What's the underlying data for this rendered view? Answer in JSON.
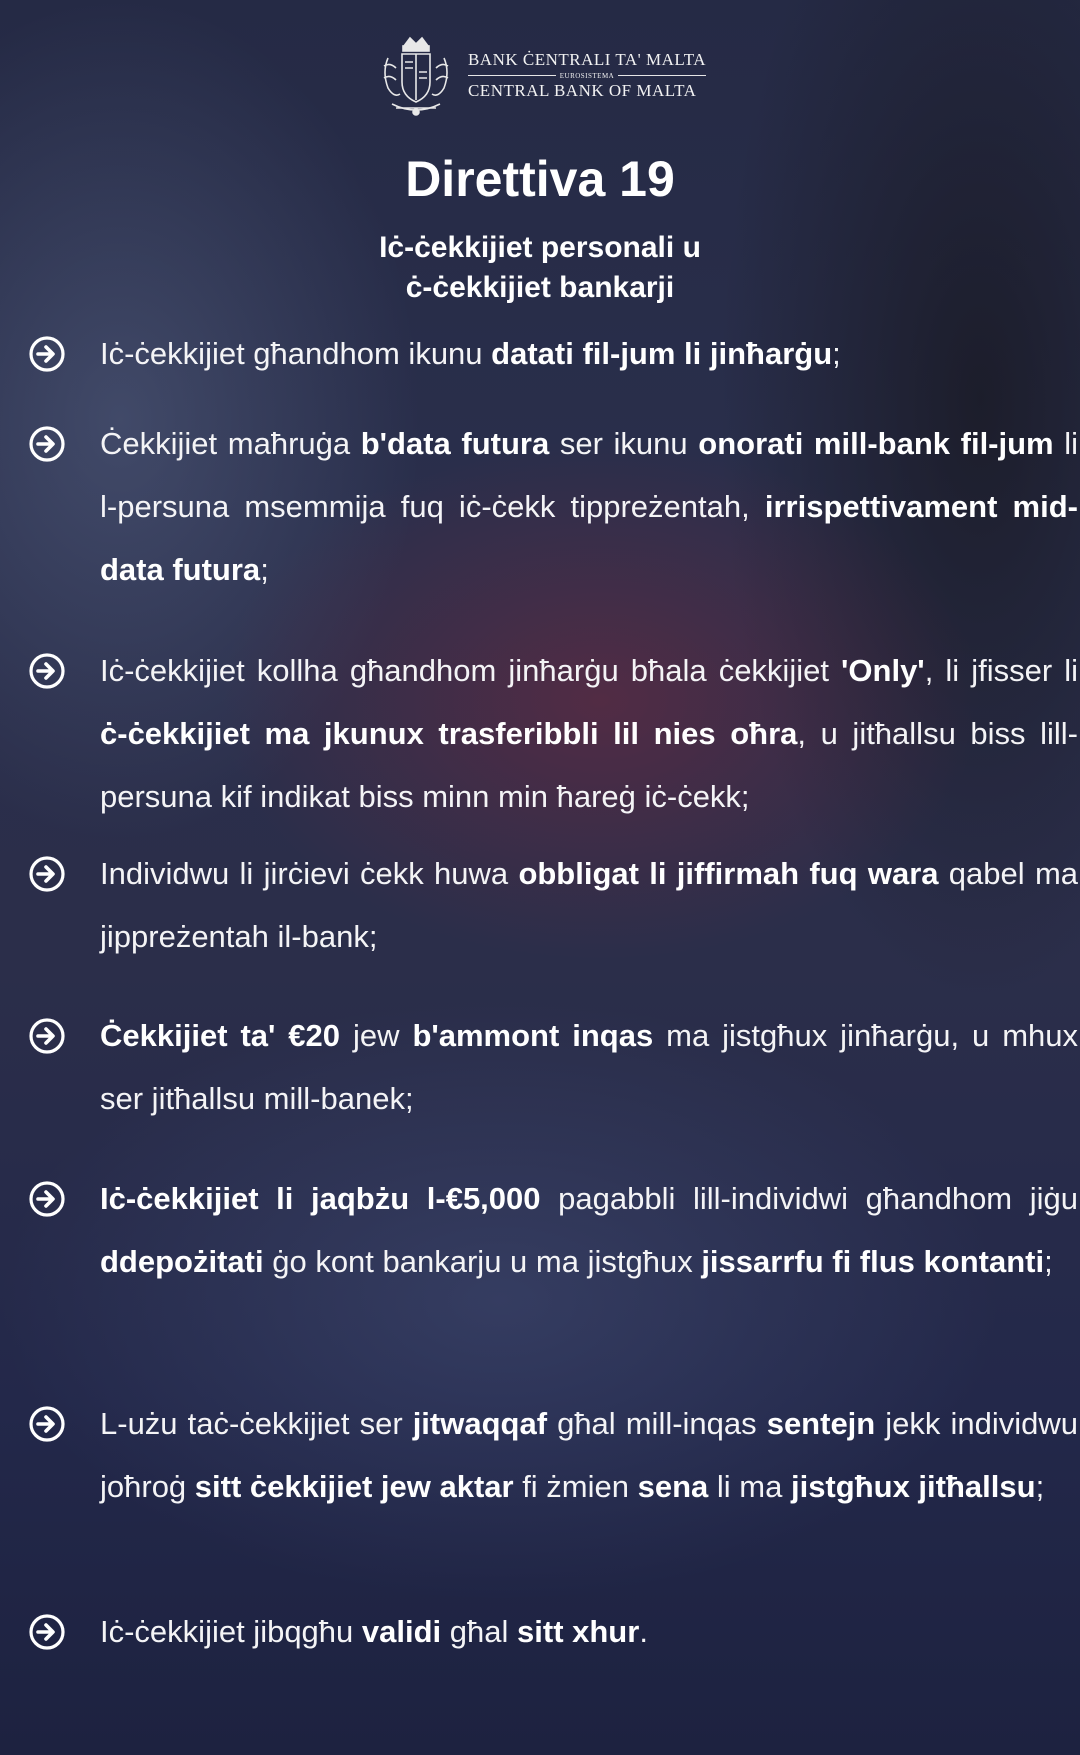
{
  "header": {
    "bank_name_mt": "BANK ĊENTRALI TA' MALTA",
    "eurosystem": "EUROSISTEMA",
    "bank_name_en": "CENTRAL BANK OF MALTA",
    "crest_icon": "coat-of-arms-icon"
  },
  "title": "Direttiva 19",
  "subtitle": {
    "line1": "Iċ-ċekkijiet personali u",
    "line2": "ċ-ċekkijiet bankarji"
  },
  "bullet_icon": "circled-arrow-right-icon",
  "items": [
    {
      "segments": [
        {
          "t": "Iċ-ċekkijiet għandhom ikunu "
        },
        {
          "t": "datati fil-jum li jinħarġu",
          "b": true
        },
        {
          "t": ";"
        }
      ]
    },
    {
      "segments": [
        {
          "t": "Ċekkijiet maħruġa "
        },
        {
          "t": "b'data futura",
          "b": true
        },
        {
          "t": " ser ikunu "
        },
        {
          "t": "onorati mill-bank fil-jum",
          "b": true
        },
        {
          "t": " li l-persuna msemmija fuq iċ-ċekk tippreżentah, "
        },
        {
          "t": "irrispettivament mid-data futura",
          "b": true
        },
        {
          "t": ";"
        }
      ]
    },
    {
      "segments": [
        {
          "t": "Iċ-ċekkijiet kollha għandhom jinħarġu bħala ċekkijiet "
        },
        {
          "t": "'Only'",
          "b": true
        },
        {
          "t": ", li jfisser li "
        },
        {
          "t": "ċ-ċekkijiet ma jkunux trasferibbli lil nies oħra",
          "b": true
        },
        {
          "t": ", u jitħallsu biss lill-persuna kif indikat biss minn min ħareġ iċ-ċekk;"
        }
      ]
    },
    {
      "segments": [
        {
          "t": "Individwu li jirċievi ċekk huwa "
        },
        {
          "t": "obbligat li jiffirmah fuq wara",
          "b": true
        },
        {
          "t": " qabel ma jippreżentah il-bank;"
        }
      ]
    },
    {
      "segments": [
        {
          "t": "Ċekkijiet ta' €20",
          "b": true
        },
        {
          "t": " jew "
        },
        {
          "t": "b'ammont inqas",
          "b": true
        },
        {
          "t": " ma jistgħux jinħarġu, u mhux ser jitħallsu mill-banek;"
        }
      ]
    },
    {
      "segments": [
        {
          "t": "Iċ-ċekkijiet li jaqbżu l-€5,000",
          "b": true
        },
        {
          "t": " pagabbli lill-individwi għandhom jiġu "
        },
        {
          "t": "ddepożitati",
          "b": true
        },
        {
          "t": " ġo kont bankarju u ma jistgħux "
        },
        {
          "t": "jissarrfu fi flus kontanti",
          "b": true
        },
        {
          "t": ";"
        }
      ]
    },
    {
      "segments": [
        {
          "t": "L-użu taċ-ċekkijiet ser "
        },
        {
          "t": "jitwaqqaf",
          "b": true
        },
        {
          "t": " għal mill-inqas "
        },
        {
          "t": "sentejn",
          "b": true
        },
        {
          "t": " jekk individwu joħroġ "
        },
        {
          "t": "sitt ċekkijiet jew aktar",
          "b": true
        },
        {
          "t": " fi żmien "
        },
        {
          "t": "sena",
          "b": true
        },
        {
          "t": " li ma "
        },
        {
          "t": "jistgħux jitħallsu",
          "b": true
        },
        {
          "t": ";"
        }
      ]
    },
    {
      "segments": [
        {
          "t": "Iċ-ċekkijiet jibqgħu "
        },
        {
          "t": "validi",
          "b": true
        },
        {
          "t": " għal "
        },
        {
          "t": "sitt xhur",
          "b": true
        },
        {
          "t": "."
        }
      ]
    }
  ]
}
